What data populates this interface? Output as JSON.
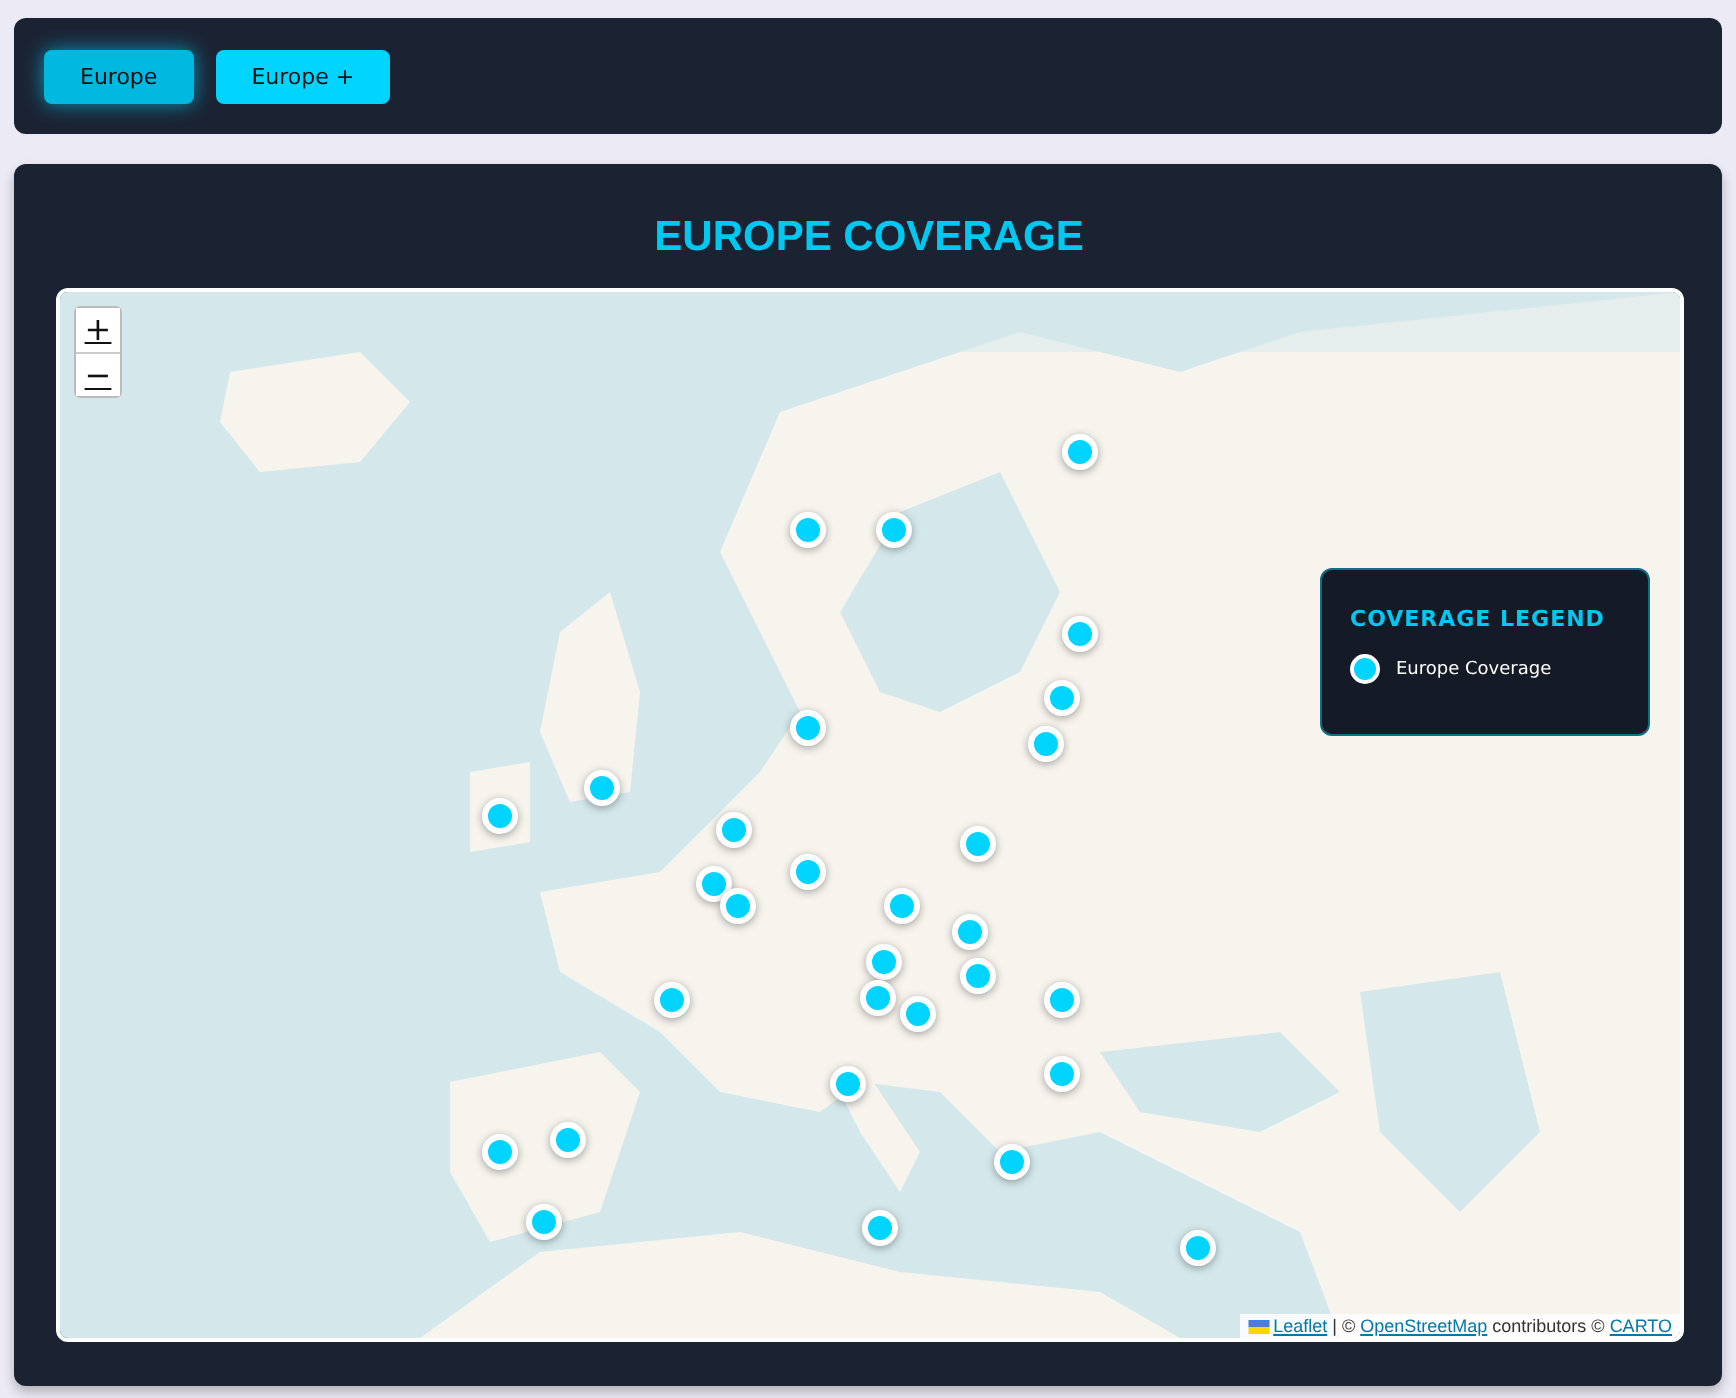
{
  "tabs": [
    {
      "label": "Europe",
      "selected": true
    },
    {
      "label": "Europe +",
      "selected": false
    }
  ],
  "title": "EUROPE COVERAGE",
  "map": {
    "zoom_controls": [
      "+",
      "−"
    ],
    "legend": {
      "title": "COVERAGE LEGEND",
      "items": [
        {
          "label": "Europe Coverage",
          "color": "#00d4ff"
        }
      ]
    },
    "attribution": [
      {
        "text": "Leaflet",
        "link": true
      },
      {
        "text": " | © ",
        "link": false
      },
      {
        "text": "OpenStreetMap",
        "link": true
      },
      {
        "text": " contributors © ",
        "link": false
      },
      {
        "text": "CARTO",
        "link": true
      }
    ]
  }
}
